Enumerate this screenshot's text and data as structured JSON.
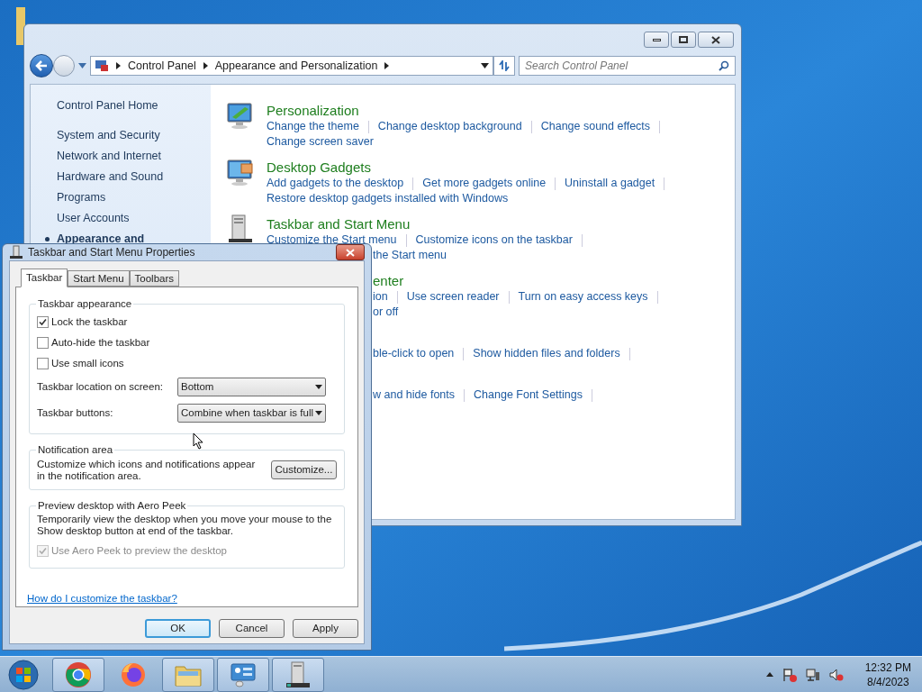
{
  "control_panel": {
    "breadcrumbs": [
      "Control Panel",
      "Appearance and Personalization"
    ],
    "search": {
      "placeholder": "Search Control Panel"
    },
    "sidebar": [
      {
        "label": "Control Panel Home",
        "selected": false
      },
      {
        "label": "System and Security",
        "selected": false
      },
      {
        "label": "Network and Internet",
        "selected": false
      },
      {
        "label": "Hardware and Sound",
        "selected": false
      },
      {
        "label": "Programs",
        "selected": false
      },
      {
        "label": "User Accounts",
        "selected": false
      },
      {
        "label": "Appearance and",
        "selected": true
      }
    ],
    "sections": [
      {
        "kind": "personalization",
        "title": "Personalization",
        "rows": [
          [
            "Change the theme",
            "Change desktop background",
            "Change sound effects"
          ],
          [
            "Change screen saver"
          ]
        ]
      },
      {
        "kind": "gadgets",
        "title": "Desktop Gadgets",
        "rows": [
          [
            "Add gadgets to the desktop",
            "Get more gadgets online",
            "Uninstall a gadget"
          ],
          [
            "Restore desktop gadgets installed with Windows"
          ]
        ]
      },
      {
        "kind": "taskbar",
        "title": "Taskbar and Start Menu",
        "rows": [
          [
            "Customize the Start menu",
            "Customize icons on the taskbar"
          ],
          [
            "the Start menu"
          ]
        ]
      },
      {
        "kind": "hidden",
        "title": "enter",
        "rows": [
          [
            "ion",
            "Use screen reader",
            "Turn on easy access keys"
          ],
          [
            "or off"
          ]
        ]
      },
      {
        "kind": "hidden",
        "rows": [
          [
            "ble-click to open",
            "Show hidden files and folders"
          ]
        ]
      },
      {
        "kind": "hidden",
        "rows": [
          [
            "w and hide fonts",
            "Change Font Settings"
          ]
        ]
      }
    ]
  },
  "dialog": {
    "title": "Taskbar and Start Menu Properties",
    "tabs": [
      {
        "label": "Taskbar",
        "selected": true
      },
      {
        "label": "Start Menu",
        "selected": false
      },
      {
        "label": "Toolbars",
        "selected": false
      }
    ],
    "appearance": {
      "legend": "Taskbar appearance",
      "checkboxes": [
        {
          "label": "Lock the taskbar",
          "checked": true
        },
        {
          "label": "Auto-hide the taskbar",
          "checked": false
        },
        {
          "label": "Use small icons",
          "checked": false
        }
      ],
      "selects": [
        {
          "label": "Taskbar location on screen:",
          "value": "Bottom"
        },
        {
          "label": "Taskbar buttons:",
          "value": "Combine when taskbar is full"
        }
      ]
    },
    "notification": {
      "legend": "Notification area",
      "text": "Customize which icons and notifications appear in the notification area.",
      "button": "Customize..."
    },
    "peek": {
      "legend": "Preview desktop with Aero Peek",
      "text": "Temporarily view the desktop when you move your mouse to the Show desktop button at end of the taskbar.",
      "checkbox": {
        "label": "Use Aero Peek to preview the desktop",
        "checked": true,
        "disabled": true
      }
    },
    "help_link": "How do I customize the taskbar?",
    "buttons": [
      {
        "label": "OK",
        "default": true
      },
      {
        "label": "Cancel",
        "default": false
      },
      {
        "label": "Apply",
        "default": false
      }
    ]
  },
  "taskbar": {
    "apps": [
      {
        "kind": "chrome",
        "open": true
      },
      {
        "kind": "firefox",
        "open": false
      },
      {
        "kind": "explorer",
        "open": true
      },
      {
        "kind": "control-panel",
        "open": true
      },
      {
        "kind": "taskbar-properties",
        "open": true
      }
    ],
    "clock": {
      "time": "12:32 PM",
      "date": "8/4/2023"
    }
  }
}
